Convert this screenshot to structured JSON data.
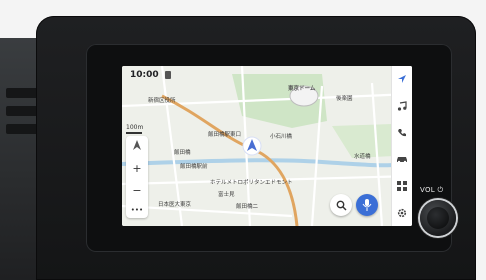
{
  "status": {
    "time": "10:00"
  },
  "map": {
    "labels": [
      "新宿区役所",
      "東京ドーム",
      "飯田橋駅東口",
      "後楽園",
      "飯田橋",
      "小石川橋",
      "水道橋",
      "ホテルメトロポリタンエドモント",
      "日本医大東京",
      "飯田橋駅前",
      "富士見",
      "飯田橋二"
    ],
    "scale": "100m"
  },
  "zoom": {
    "plus": "+",
    "minus": "−",
    "more": "•••"
  },
  "hardware": {
    "vol_label": "VOL ⏻"
  },
  "colors": {
    "route": "#e0a560",
    "water": "#aed1e8",
    "park": "#cfe5c6",
    "mic": "#3b6fd6",
    "nav": "#4a6fd3"
  },
  "rail_icons": [
    "navigation-icon",
    "music-icon",
    "phone-icon",
    "car-icon",
    "apps-grid-icon",
    "settings-icon"
  ]
}
